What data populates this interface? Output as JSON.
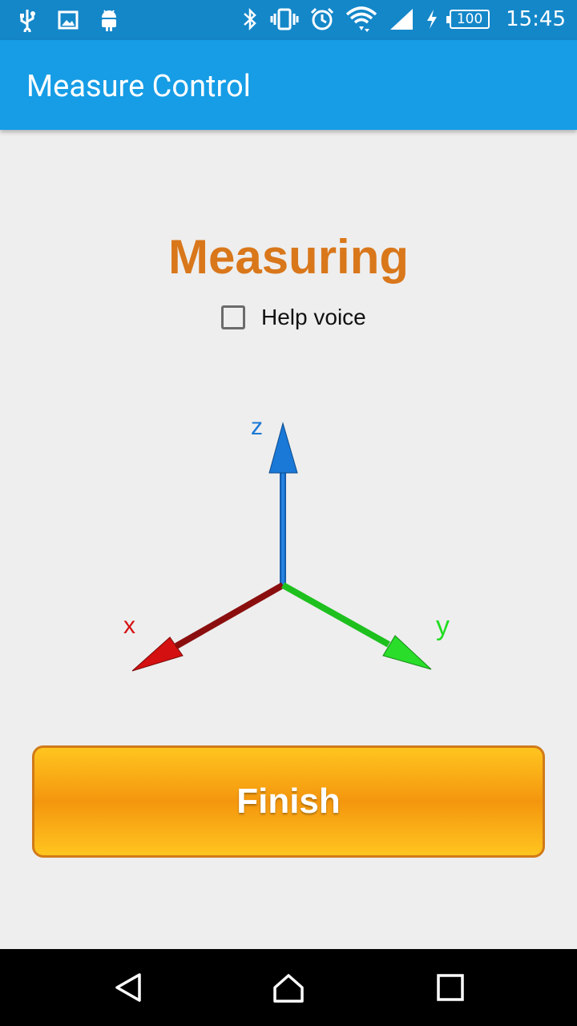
{
  "status_bar": {
    "time": "15:45",
    "battery_level": "100",
    "left_icons": [
      "usb-icon",
      "image-icon",
      "android-icon"
    ],
    "right_icons": [
      "bluetooth-icon",
      "vibrate-icon",
      "alarm-icon",
      "wifi-icon",
      "signal-icon",
      "charging-icon",
      "battery-icon"
    ]
  },
  "app_bar": {
    "title": "Measure Control"
  },
  "main": {
    "heading": "Measuring",
    "help_voice": {
      "label": "Help voice",
      "checked": false
    },
    "axes": {
      "x_label": "x",
      "y_label": "y",
      "z_label": "z"
    },
    "finish_button": "Finish"
  },
  "nav_bar": {
    "buttons": [
      "back-icon",
      "home-icon",
      "recents-icon"
    ]
  },
  "colors": {
    "status_bar": "#1487c9",
    "app_bar": "#169de6",
    "heading": "#d9771b",
    "button_top": "#ffc51f",
    "button_mid": "#f4960e",
    "axis_x": "#cc1111",
    "axis_y": "#22dd22",
    "axis_z": "#1a78d6"
  }
}
